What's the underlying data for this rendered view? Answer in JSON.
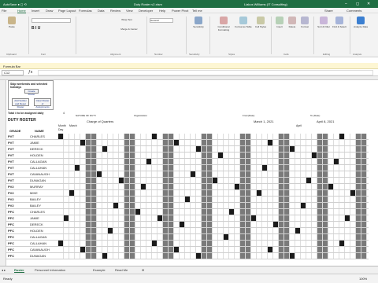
{
  "window": {
    "title": "Duty Roster v2.xlsm",
    "user": "Liakos Williams (IT Consulting)",
    "search": "Search"
  },
  "tabs": [
    "File",
    "Home",
    "Insert",
    "Draw",
    "Page Layout",
    "Formulas",
    "Data",
    "Review",
    "View",
    "Developer",
    "Help",
    "Power Pivot",
    "Tell me"
  ],
  "ribbon": {
    "groups": [
      "Clipboard",
      "Font",
      "Alignment",
      "Number",
      "Sensitivity",
      "Styles",
      "Cells",
      "Editing",
      "Analysis"
    ],
    "buttons": [
      "Paste",
      "Wrap Text",
      "Merge & Center",
      "General",
      "Sensitivity",
      "Conditional Formatting",
      "Format as Table",
      "Cell Styles",
      "Insert",
      "Delete",
      "Format",
      "Sort & Filter",
      "Find & Select",
      "Analyze Data"
    ],
    "share": "Share",
    "comments": "Comments"
  },
  "message": "Formula Bar",
  "namebox": "C12",
  "top": {
    "title": "Skip weekends and selected holidays",
    "create": "Create Roster",
    "add": "Add Soldier and Reset Roster",
    "clear": "Clear Roster of Assignments",
    "total": "Total # to be assigned daily",
    "total_val": "4"
  },
  "info": {
    "roster_label": "DUTY ROSTER",
    "nature": "NATURE OF DUTY",
    "duty": "Charge of Quarters",
    "org_label": "Organization",
    "from_label": "From(Date)",
    "from": "March 1, 2021",
    "to_label": "To (Date)",
    "to": "April 8, 2021",
    "month_label": "Month",
    "march": "March",
    "april": "April",
    "day_label": "Day",
    "grade_hdr": "GRADE",
    "name_hdr": "NAME"
  },
  "rows": [
    {
      "g": "PVT",
      "n": "CHARLES"
    },
    {
      "g": "PVT",
      "n": "JAMIE"
    },
    {
      "g": "PVT",
      "n": "DERECK"
    },
    {
      "g": "PVT",
      "n": "HOLDEN"
    },
    {
      "g": "PVT",
      "n": "CALLAGAN"
    },
    {
      "g": "PVT",
      "n": "CALLAHAN"
    },
    {
      "g": "PVT",
      "n": "CAVANAUGH"
    },
    {
      "g": "PVT",
      "n": "DUNAGAN"
    },
    {
      "g": "PV2",
      "n": "MURRAY"
    },
    {
      "g": "PV2",
      "n": "MIKE"
    },
    {
      "g": "PV2",
      "n": "BAILEY"
    },
    {
      "g": "PV2",
      "n": "BAILEY"
    },
    {
      "g": "PFC",
      "n": "CHARLES"
    },
    {
      "g": "PFC",
      "n": "JAMIE"
    },
    {
      "g": "PFC",
      "n": "DERECK"
    },
    {
      "g": "PFC",
      "n": "HOLDEN"
    },
    {
      "g": "PFC",
      "n": "CALLAGAN"
    },
    {
      "g": "PFC",
      "n": "CALLAHAN"
    },
    {
      "g": "PFC",
      "n": "CAVANAUGH"
    },
    {
      "g": "PFC",
      "n": "DUNAGAN"
    }
  ],
  "sheets": [
    "Roster",
    "Personnel Information",
    "Example",
    "Read Me"
  ],
  "status": {
    "ready": "Ready",
    "zoom": "100%"
  }
}
